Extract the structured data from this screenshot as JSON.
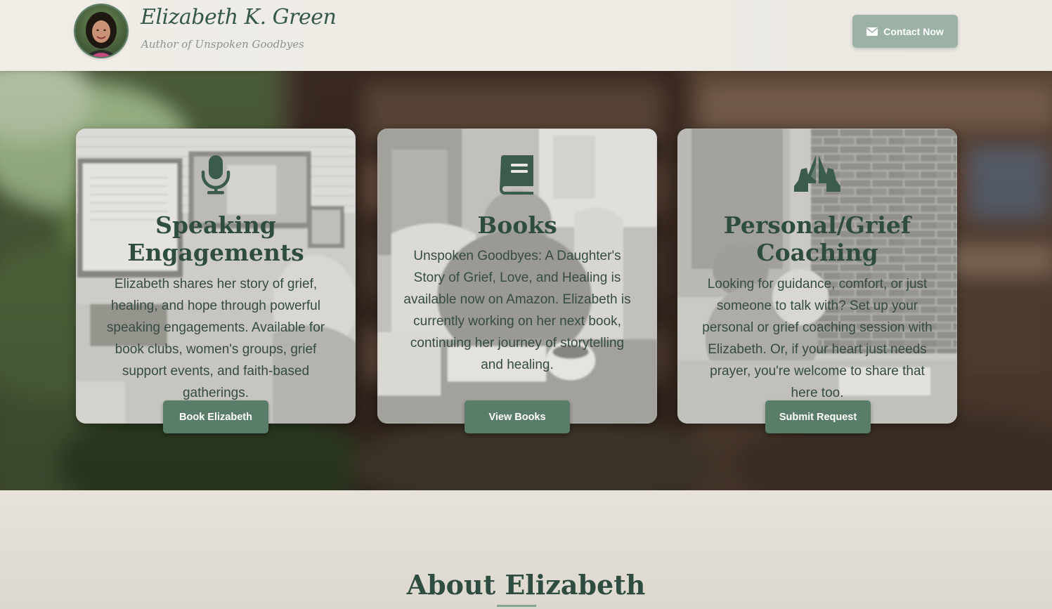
{
  "header": {
    "name": "Elizabeth K. Green",
    "tagline": "Author of Unspoken Goodbyes",
    "contact_label": "Contact Now",
    "contact_icon": "envelope-icon",
    "avatar": "avatar-photo"
  },
  "cards": [
    {
      "icon": "microphone-icon",
      "title": "Speaking Engagements",
      "text": "Elizabeth shares her story of grief, healing, and hope through powerful speaking engagements. Available for book clubs, women's groups, grief support events, and faith-based gatherings.",
      "button": "Book Elizabeth"
    },
    {
      "icon": "book-icon",
      "title": "Books",
      "text": "Unspoken Goodbyes: A Daughter's Story of Grief, Love, and Healing is available now on Amazon. Elizabeth is currently working on her next book, continuing her journey of storytelling and healing.",
      "button": "View Books"
    },
    {
      "icon": "praying-hands-icon",
      "title": "Personal/Grief Coaching",
      "text": "Looking for guidance, comfort, or just someone to talk with? Set up your personal or grief coaching session with Elizabeth. Or, if your heart just needs prayer, you're welcome to share that here too.",
      "button": "Submit Request"
    }
  ],
  "about": {
    "title": "About Elizabeth"
  },
  "colors": {
    "primary_green": "#5a7d69",
    "heading_green": "#2e4d40",
    "contact_button": "#9cb2a6",
    "header_bg": "#eeece5"
  }
}
